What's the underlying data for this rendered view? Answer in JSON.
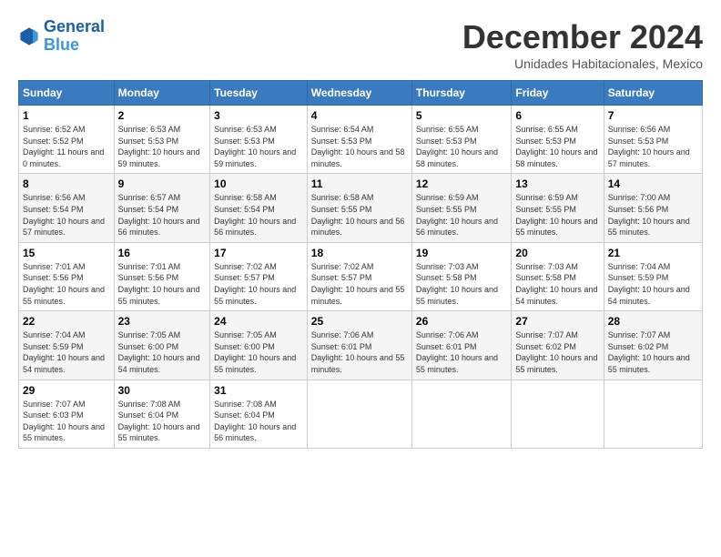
{
  "logo": {
    "line1": "General",
    "line2": "Blue"
  },
  "title": "December 2024",
  "subtitle": "Unidades Habitacionales, Mexico",
  "days_of_week": [
    "Sunday",
    "Monday",
    "Tuesday",
    "Wednesday",
    "Thursday",
    "Friday",
    "Saturday"
  ],
  "weeks": [
    [
      {
        "day": "1",
        "sunrise": "6:52 AM",
        "sunset": "5:52 PM",
        "daylight": "11 hours and 0 minutes."
      },
      {
        "day": "2",
        "sunrise": "6:53 AM",
        "sunset": "5:53 PM",
        "daylight": "10 hours and 59 minutes."
      },
      {
        "day": "3",
        "sunrise": "6:53 AM",
        "sunset": "5:53 PM",
        "daylight": "10 hours and 59 minutes."
      },
      {
        "day": "4",
        "sunrise": "6:54 AM",
        "sunset": "5:53 PM",
        "daylight": "10 hours and 58 minutes."
      },
      {
        "day": "5",
        "sunrise": "6:55 AM",
        "sunset": "5:53 PM",
        "daylight": "10 hours and 58 minutes."
      },
      {
        "day": "6",
        "sunrise": "6:55 AM",
        "sunset": "5:53 PM",
        "daylight": "10 hours and 58 minutes."
      },
      {
        "day": "7",
        "sunrise": "6:56 AM",
        "sunset": "5:53 PM",
        "daylight": "10 hours and 57 minutes."
      }
    ],
    [
      {
        "day": "8",
        "sunrise": "6:56 AM",
        "sunset": "5:54 PM",
        "daylight": "10 hours and 57 minutes."
      },
      {
        "day": "9",
        "sunrise": "6:57 AM",
        "sunset": "5:54 PM",
        "daylight": "10 hours and 56 minutes."
      },
      {
        "day": "10",
        "sunrise": "6:58 AM",
        "sunset": "5:54 PM",
        "daylight": "10 hours and 56 minutes."
      },
      {
        "day": "11",
        "sunrise": "6:58 AM",
        "sunset": "5:55 PM",
        "daylight": "10 hours and 56 minutes."
      },
      {
        "day": "12",
        "sunrise": "6:59 AM",
        "sunset": "5:55 PM",
        "daylight": "10 hours and 56 minutes."
      },
      {
        "day": "13",
        "sunrise": "6:59 AM",
        "sunset": "5:55 PM",
        "daylight": "10 hours and 55 minutes."
      },
      {
        "day": "14",
        "sunrise": "7:00 AM",
        "sunset": "5:56 PM",
        "daylight": "10 hours and 55 minutes."
      }
    ],
    [
      {
        "day": "15",
        "sunrise": "7:01 AM",
        "sunset": "5:56 PM",
        "daylight": "10 hours and 55 minutes."
      },
      {
        "day": "16",
        "sunrise": "7:01 AM",
        "sunset": "5:56 PM",
        "daylight": "10 hours and 55 minutes."
      },
      {
        "day": "17",
        "sunrise": "7:02 AM",
        "sunset": "5:57 PM",
        "daylight": "10 hours and 55 minutes."
      },
      {
        "day": "18",
        "sunrise": "7:02 AM",
        "sunset": "5:57 PM",
        "daylight": "10 hours and 55 minutes."
      },
      {
        "day": "19",
        "sunrise": "7:03 AM",
        "sunset": "5:58 PM",
        "daylight": "10 hours and 55 minutes."
      },
      {
        "day": "20",
        "sunrise": "7:03 AM",
        "sunset": "5:58 PM",
        "daylight": "10 hours and 54 minutes."
      },
      {
        "day": "21",
        "sunrise": "7:04 AM",
        "sunset": "5:59 PM",
        "daylight": "10 hours and 54 minutes."
      }
    ],
    [
      {
        "day": "22",
        "sunrise": "7:04 AM",
        "sunset": "5:59 PM",
        "daylight": "10 hours and 54 minutes."
      },
      {
        "day": "23",
        "sunrise": "7:05 AM",
        "sunset": "6:00 PM",
        "daylight": "10 hours and 54 minutes."
      },
      {
        "day": "24",
        "sunrise": "7:05 AM",
        "sunset": "6:00 PM",
        "daylight": "10 hours and 55 minutes."
      },
      {
        "day": "25",
        "sunrise": "7:06 AM",
        "sunset": "6:01 PM",
        "daylight": "10 hours and 55 minutes."
      },
      {
        "day": "26",
        "sunrise": "7:06 AM",
        "sunset": "6:01 PM",
        "daylight": "10 hours and 55 minutes."
      },
      {
        "day": "27",
        "sunrise": "7:07 AM",
        "sunset": "6:02 PM",
        "daylight": "10 hours and 55 minutes."
      },
      {
        "day": "28",
        "sunrise": "7:07 AM",
        "sunset": "6:02 PM",
        "daylight": "10 hours and 55 minutes."
      }
    ],
    [
      {
        "day": "29",
        "sunrise": "7:07 AM",
        "sunset": "6:03 PM",
        "daylight": "10 hours and 55 minutes."
      },
      {
        "day": "30",
        "sunrise": "7:08 AM",
        "sunset": "6:04 PM",
        "daylight": "10 hours and 55 minutes."
      },
      {
        "day": "31",
        "sunrise": "7:08 AM",
        "sunset": "6:04 PM",
        "daylight": "10 hours and 56 minutes."
      },
      null,
      null,
      null,
      null
    ]
  ]
}
